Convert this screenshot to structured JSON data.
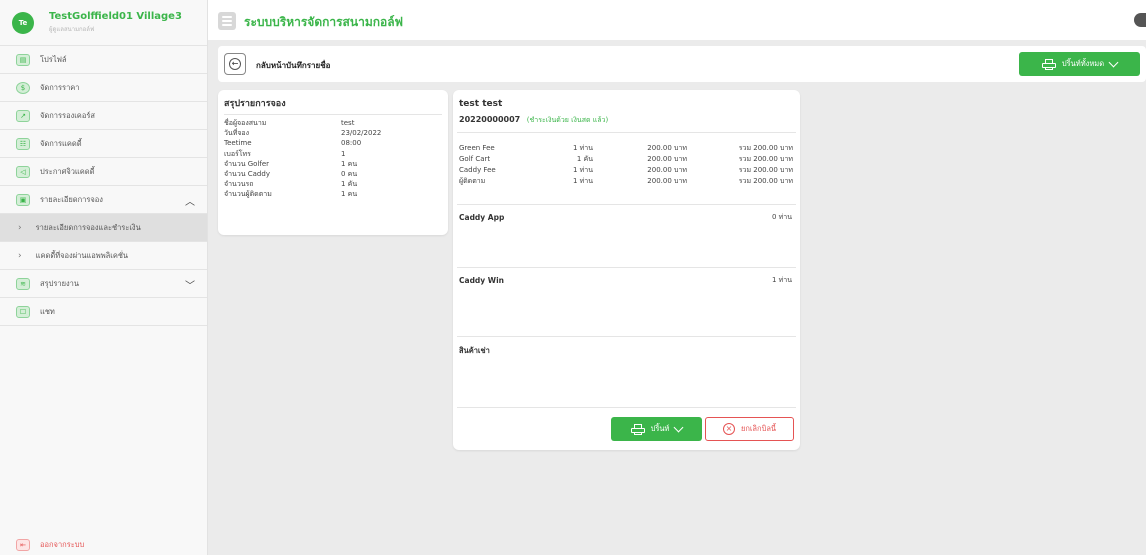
{
  "user": {
    "initials": "Te",
    "name": "TestGolffield01 Village3",
    "role": "ผู้ดูแลสนามกอล์ฟ"
  },
  "sidebar": {
    "items": [
      {
        "label": "โปรไฟล์",
        "icon": "id-card-icon"
      },
      {
        "label": "จัดการราคา",
        "icon": "dollar-icon"
      },
      {
        "label": "จัดการรองเคอร์ส",
        "icon": "chart-icon"
      },
      {
        "label": "จัดการแคดดี้",
        "icon": "users-icon"
      },
      {
        "label": "ประกาศจิวแคดดี้",
        "icon": "megaphone-icon"
      },
      {
        "label": "รายละเอียดการจอง",
        "icon": "list-icon"
      },
      {
        "label": "รายละเอียดการจองและชำระเงิน",
        "icon": "chevron-right-icon"
      },
      {
        "label": "แคดดี้ที่จองผ่านแอพพลิเคชั่น",
        "icon": "chevron-right-icon"
      },
      {
        "label": "สรุปรายงาน",
        "icon": "layers-icon"
      },
      {
        "label": "แชท",
        "icon": "chat-icon"
      }
    ],
    "logout_label": "ออกจากระบบ"
  },
  "header": {
    "title": "ระบบบริหารจัดการสนามกอล์ฟ"
  },
  "toolbar": {
    "back_label": "กลับหน้าบันทึกรายชื่อ",
    "print_all_label": "ปริ้นท์ทั้งหมด"
  },
  "summary": {
    "title": "สรุปรายการจอง",
    "fields": [
      {
        "key": "ชื่อผู้จองสนาม",
        "value": "test"
      },
      {
        "key": "วันที่จอง",
        "value": "23/02/2022"
      },
      {
        "key": "Teetime",
        "value": "08:00"
      },
      {
        "key": "เบอร์โทร",
        "value": "1"
      },
      {
        "key": "จำนวน Golfer",
        "value": "1 คน"
      },
      {
        "key": "จำนวน Caddy",
        "value": "0 คน"
      },
      {
        "key": "จำนวนรถ",
        "value": "1 คัน"
      },
      {
        "key": "จำนวนผู้ติดตาม",
        "value": "1 คน"
      }
    ]
  },
  "detail": {
    "name": "test test",
    "booking_no": "20220000007",
    "payment_status": "(ชำระเงินด้วย เงินสด แล้ว)",
    "fees": [
      {
        "item": "Green Fee",
        "qty": "1 ท่าน",
        "price": "200.00 บาท",
        "total": "รวม 200.00 บาท"
      },
      {
        "item": "Golf Cart",
        "qty": "1 คัน",
        "price": "200.00 บาท",
        "total": "รวม 200.00 บาท"
      },
      {
        "item": "Caddy Fee",
        "qty": "1 ท่าน",
        "price": "200.00 บาท",
        "total": "รวม 200.00 บาท"
      },
      {
        "item": "ผู้ติดตาม",
        "qty": "1 ท่าน",
        "price": "200.00 บาท",
        "total": "รวม 200.00 บาท"
      }
    ],
    "caddy_app": {
      "label": "Caddy App",
      "value": "0 ท่าน"
    },
    "caddy_win": {
      "label": "Caddy Win",
      "value": "1 ท่าน"
    },
    "products": {
      "label": "สินค้าเช่า"
    },
    "print_label": "ปริ้นท์",
    "cancel_label": "ยกเลิกบิลนี้"
  },
  "colors": {
    "brand_green": "#3bb54a",
    "danger_red": "#e55353"
  }
}
